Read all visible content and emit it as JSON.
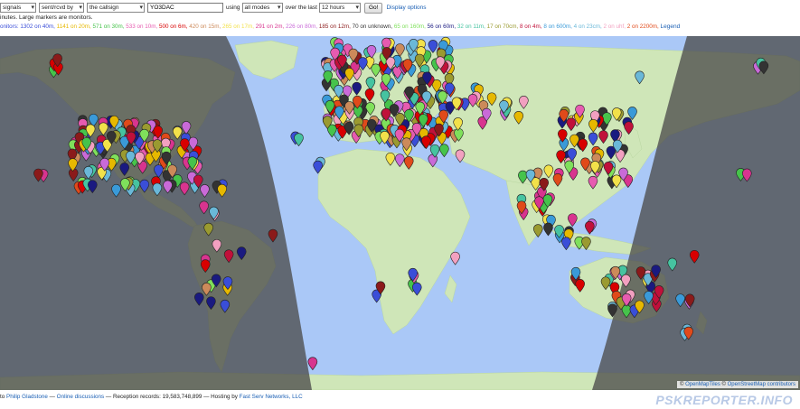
{
  "toolbar": {
    "show_select": "signals",
    "direction_select": "sent/rcvd by",
    "target_select": "the callsign",
    "callsign_value": "YO3DAC",
    "using_label": "using",
    "mode_select": "all modes",
    "over_label": "over the last",
    "period_select": "12 hours",
    "go_label": "Go!",
    "display_options": "Display options"
  },
  "info_line": "inutes. Large markers are monitors.",
  "monitors_prefix": "onitors:",
  "monitor_counts": [
    {
      "text": "1302 on 40m,",
      "color": "#3a4ed8"
    },
    {
      "text": "1141 on 20m,",
      "color": "#e6b800"
    },
    {
      "text": "571 on 30m,",
      "color": "#46c34b"
    },
    {
      "text": "533 on 10m,",
      "color": "#e65bb0"
    },
    {
      "text": "500 on 6m,",
      "color": "#d80000"
    },
    {
      "text": "420 on 15m,",
      "color": "#cc8a5a"
    },
    {
      "text": "265 on 17m,",
      "color": "#f2e14a"
    },
    {
      "text": "291 on 2m,",
      "color": "#d8348f"
    },
    {
      "text": "226 on 80m,",
      "color": "#c96ad8"
    },
    {
      "text": "185 on 12m,",
      "color": "#8b1a1a"
    },
    {
      "text": "70 on unknown,",
      "color": "#333333"
    },
    {
      "text": "65 on 160m,",
      "color": "#7fe05b"
    },
    {
      "text": "56 on 60m,",
      "color": "#1a1a80"
    },
    {
      "text": "32 on 11m,",
      "color": "#46c3a0"
    },
    {
      "text": "17 on 70cm,",
      "color": "#9a9a30"
    },
    {
      "text": "8 on 4m,",
      "color": "#c0103a"
    },
    {
      "text": "8 on 600m,",
      "color": "#3a9ad8"
    },
    {
      "text": "4 on 23cm,",
      "color": "#6ab8d8"
    },
    {
      "text": "2 on uhf,",
      "color": "#f2a0c0"
    },
    {
      "text": "2 on 2200m,",
      "color": "#e04a1a"
    }
  ],
  "legend_link": "Legend",
  "attribution": {
    "sep": "©",
    "tiles": "OpenMapTiles",
    "osm": "OpenStreetMap contributors"
  },
  "footer": {
    "prefix": "to",
    "author": "Philip Gladstone",
    "sep1": "—",
    "discussions": "Online discussions",
    "records": "— Reception records: 19,583,748,899 — Hosting by",
    "host": "Fast Serv Networks, LLC"
  },
  "logo": "PSKREPORTER.INFO",
  "colors": {
    "ocean": "#aac8f7",
    "land": "#cfe6b8",
    "night": "#4d4d4d",
    "link": "#1a5fb4"
  }
}
